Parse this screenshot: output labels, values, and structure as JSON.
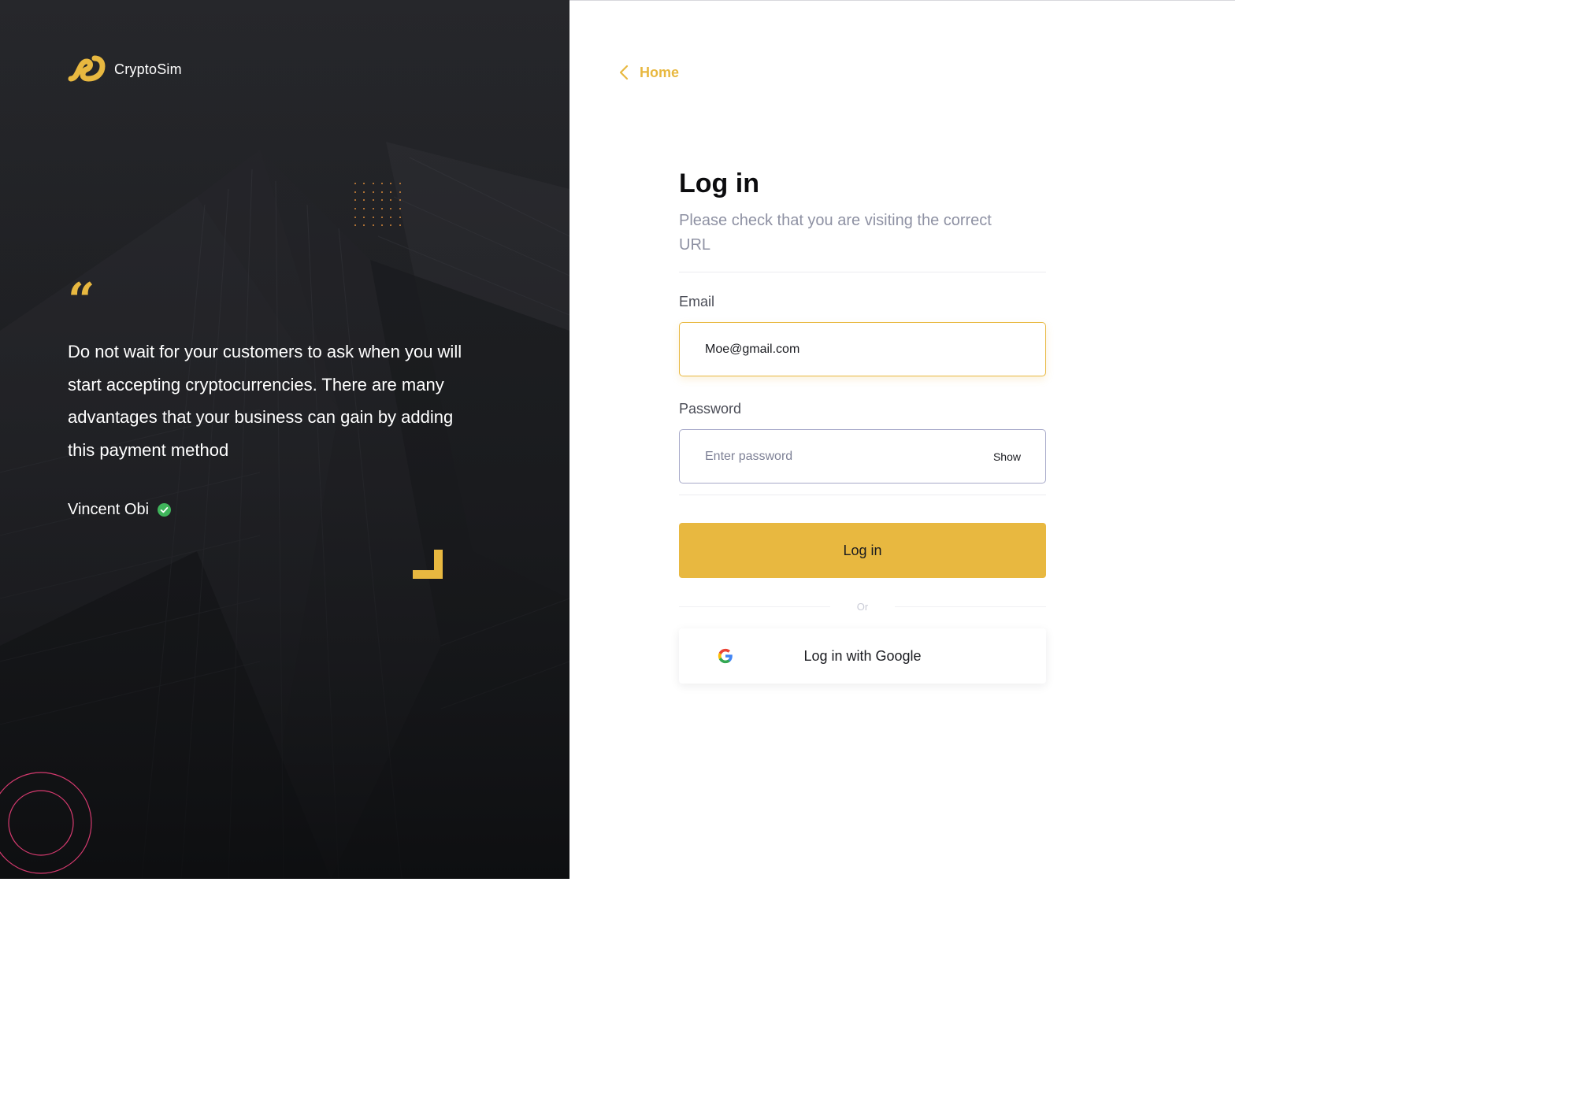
{
  "brand": {
    "name": "CryptoSim"
  },
  "testimonial": {
    "quote_mark": "“",
    "text": "Do not wait for your customers to ask when you will start accepting cryptocurrencies. There are many advantages that your business can gain by adding this payment method",
    "author": "Vincent Obi",
    "verified": true
  },
  "nav": {
    "back_label": "Home"
  },
  "login": {
    "title": "Log in",
    "subtitle": "Please check that you are visiting the correct URL",
    "email": {
      "label": "Email",
      "value": "Moe@gmail.com"
    },
    "password": {
      "label": "Password",
      "placeholder": "Enter password",
      "toggle_label": "Show"
    },
    "submit_label": "Log in",
    "divider_text": "Or",
    "google_label": "Log in with Google"
  },
  "colors": {
    "accent": "#e8b840",
    "panel_dark": "#1d1e21",
    "verified_green": "#3fb55b",
    "circle_outline": "#d63a6f",
    "dots": "#d98a3a"
  },
  "icons": {
    "brand_logo": "cryptosim-logo-icon",
    "quote": "quote-mark-icon",
    "verified": "check-circle-icon",
    "back": "chevron-left-icon",
    "google": "google-icon"
  }
}
